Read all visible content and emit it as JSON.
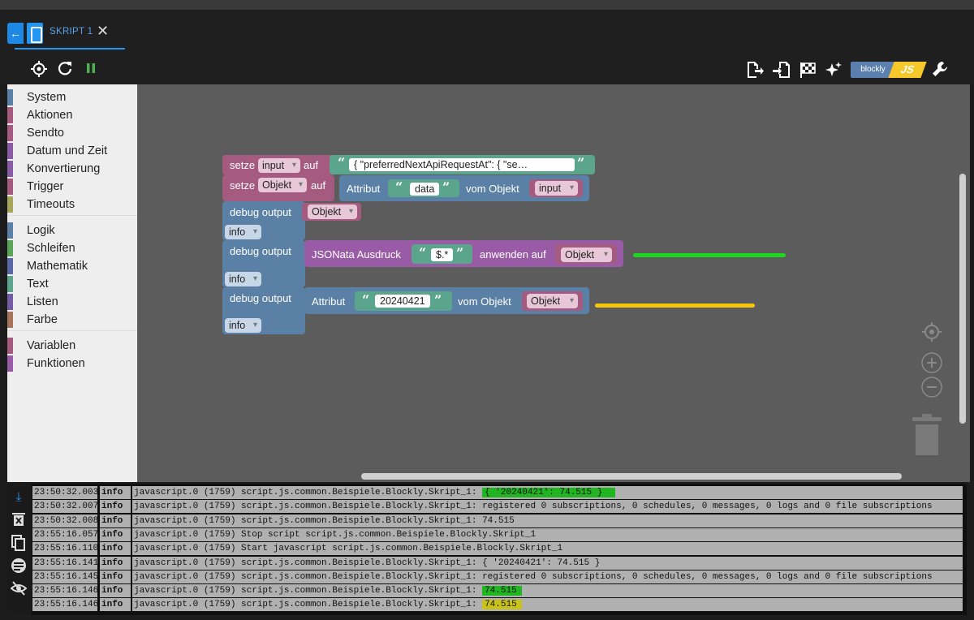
{
  "tab": {
    "back_icon": "arrow-left-icon",
    "label": "SKRIPT 1",
    "close": "✕",
    "accent": "#2196f3"
  },
  "toolbar": {
    "left_icons": [
      "target-icon",
      "refresh-icon",
      "pause-icon"
    ],
    "right_icons": [
      "export-icon",
      "import-icon",
      "flag-icon",
      "sparkle-icon",
      "blockly-js-toggle",
      "wrench-icon"
    ],
    "blockly_label": "blockly",
    "js_label": "JS"
  },
  "sidebar": {
    "items": [
      {
        "label": "System",
        "color": "#5b80a5"
      },
      {
        "label": "Aktionen",
        "color": "#a55b80"
      },
      {
        "label": "Sendto",
        "color": "#a55b80"
      },
      {
        "label": "Datum und Zeit",
        "color": "#8a5ba5"
      },
      {
        "label": "Konvertierung",
        "color": "#8a5ba5"
      },
      {
        "label": "Trigger",
        "color": "#a55b80"
      },
      {
        "label": "Timeouts",
        "color": "#a5a55b"
      },
      {
        "label": "Logik",
        "color": "#5b80a5"
      },
      {
        "label": "Schleifen",
        "color": "#5ba55b"
      },
      {
        "label": "Mathematik",
        "color": "#5b67a5"
      },
      {
        "label": "Text",
        "color": "#5ba58c"
      },
      {
        "label": "Listen",
        "color": "#745ba5"
      },
      {
        "label": "Farbe",
        "color": "#a5745b"
      },
      {
        "label": "Variablen",
        "color": "#a55b80"
      },
      {
        "label": "Funktionen",
        "color": "#995ba5"
      }
    ]
  },
  "blocks": {
    "setze1": {
      "setze": "setze",
      "var": "input",
      "auf": "auf",
      "text": "{     \"preferredNextApiRequestAt\": {          \"se…"
    },
    "setze2": {
      "setze": "setze",
      "var": "Objekt",
      "auf": "auf",
      "attribut": "Attribut",
      "attr_value": "data",
      "vom_objekt": "vom Objekt",
      "obj": "input"
    },
    "debug1": {
      "label": "debug output",
      "value": "Objekt",
      "level": "info"
    },
    "debug2": {
      "label": "debug output",
      "jsonata": "JSONata Ausdruck",
      "expr": "$.*",
      "anwenden": "anwenden auf",
      "obj": "Objekt",
      "level": "info"
    },
    "debug3": {
      "label": "debug output",
      "attribut": "Attribut",
      "attr_value": "20240421",
      "vom_objekt": "vom Objekt",
      "obj": "Objekt",
      "level": "info"
    }
  },
  "annotations": {
    "green": "#1ed81e",
    "yellow": "#f5c60c"
  },
  "console": {
    "side_icons": [
      "download-icon",
      "clear-icon",
      "copy-icon",
      "toggle-columns-icon",
      "hide-icon"
    ],
    "rows": [
      {
        "time": "23:50:32.003",
        "level": "info",
        "msg": "javascript.0 (1759) script.js.common.Beispiele.Blockly.Skript_1: ",
        "hl": "{ '20240421': 74.515 }",
        "hl_color": "#21b521"
      },
      {
        "time": "23:50:32.007",
        "level": "info",
        "msg": "javascript.0 (1759) script.js.common.Beispiele.Blockly.Skript_1: registered 0 subscriptions, 0 schedules, 0 messages, 0 logs and 0 file subscriptions",
        "hl": "",
        "hl_color": ""
      },
      {
        "time": "23:50:32.008",
        "level": "info",
        "msg": "javascript.0 (1759) script.js.common.Beispiele.Blockly.Skript_1: 74.515",
        "hl": "",
        "hl_color": ""
      },
      {
        "time": "23:55:16.057",
        "level": "info",
        "msg": "javascript.0 (1759) Stop script script.js.common.Beispiele.Blockly.Skript_1",
        "hl": "",
        "hl_color": ""
      },
      {
        "time": "23:55:16.110",
        "level": "info",
        "msg": "javascript.0 (1759) Start javascript script.js.common.Beispiele.Blockly.Skript_1",
        "hl": "",
        "hl_color": ""
      },
      {
        "time": "23:55:16.141",
        "level": "info",
        "msg": "javascript.0 (1759) script.js.common.Beispiele.Blockly.Skript_1: { '20240421': 74.515 }",
        "hl": "",
        "hl_color": ""
      },
      {
        "time": "23:55:16.145",
        "level": "info",
        "msg": "javascript.0 (1759) script.js.common.Beispiele.Blockly.Skript_1: registered 0 subscriptions, 0 schedules, 0 messages, 0 logs and 0 file subscriptions",
        "hl": "",
        "hl_color": ""
      },
      {
        "time": "23:55:16.146",
        "level": "info",
        "msg": "javascript.0 (1759) script.js.common.Beispiele.Blockly.Skript_1: ",
        "hl": "74.515",
        "hl_color": "#21b521"
      },
      {
        "time": "23:55:16.146",
        "level": "info",
        "msg": "javascript.0 (1759) script.js.common.Beispiele.Blockly.Skript_1: ",
        "hl": "74.515",
        "hl_color": "#c8c21a"
      }
    ]
  }
}
